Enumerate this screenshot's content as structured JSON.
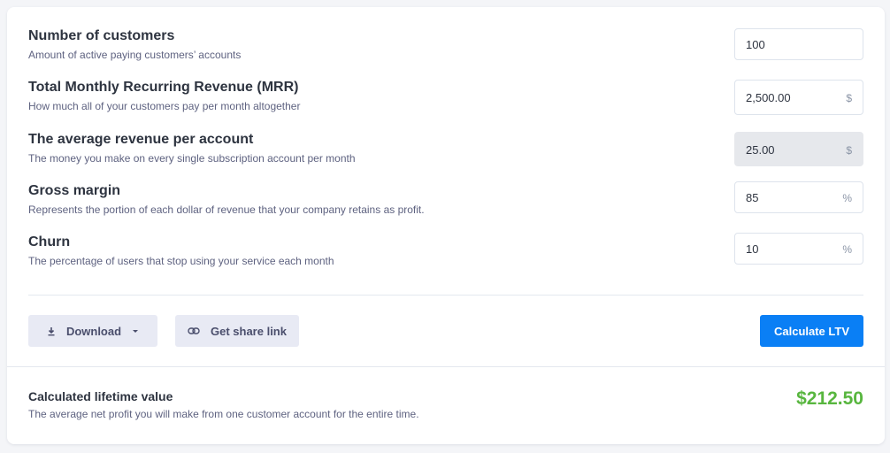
{
  "fields": [
    {
      "label": "Number of customers",
      "description": "Amount of active paying customers’ accounts",
      "value": "100",
      "unit": ""
    },
    {
      "label": "Total Monthly Recurring Revenue (MRR)",
      "description": "How much all of your customers pay per month altogether",
      "value": "2,500.00",
      "unit": "$"
    },
    {
      "label": "The average revenue per account",
      "description": "The money you make on every single subscription account per month",
      "value": "25.00",
      "unit": "$"
    },
    {
      "label": "Gross margin",
      "description": "Represents the portion of each dollar of revenue that your company retains as profit.",
      "value": "85",
      "unit": "%"
    },
    {
      "label": "Churn",
      "description": "The percentage of users that stop using your service each month",
      "value": "10",
      "unit": "%"
    }
  ],
  "actions": {
    "download_label": "Download",
    "share_label": "Get share link",
    "calculate_label": "Calculate LTV"
  },
  "result": {
    "label": "Calculated lifetime value",
    "description": "The average net profit you will make from one customer account for the entire time.",
    "value": "$212.50"
  },
  "icons": {
    "download": "download-icon",
    "dropdown": "caret-down-icon",
    "link": "link-icon"
  },
  "colors": {
    "primary": "#0a7ff5",
    "result": "#58b63f"
  }
}
